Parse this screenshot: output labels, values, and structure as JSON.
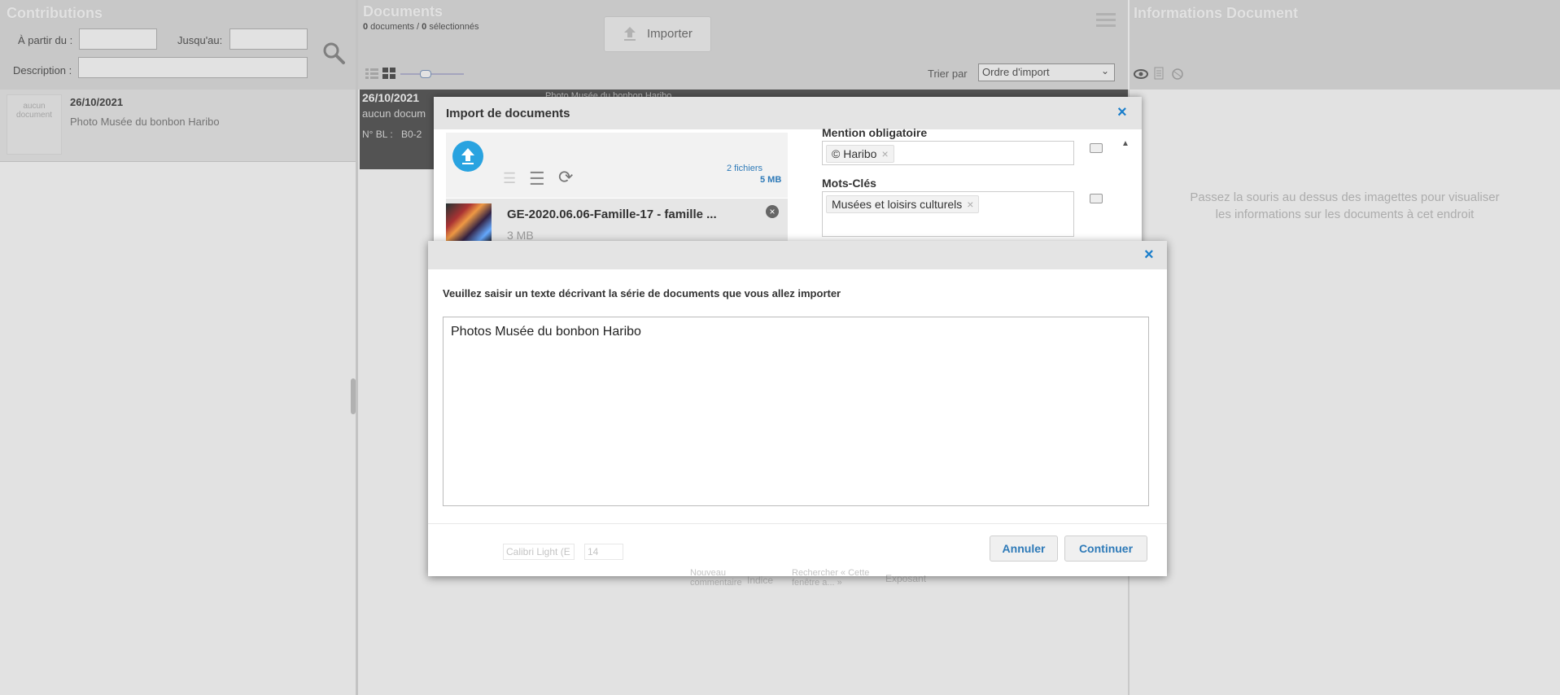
{
  "left": {
    "title": "Contributions",
    "from_label": "À partir du :",
    "to_label": "Jusqu'au:",
    "desc_label": "Description :",
    "item": {
      "thumb_text": "aucun document",
      "date": "26/10/2021",
      "description": "Photo Musée du bonbon Haribo"
    }
  },
  "middle": {
    "title": "Documents",
    "count_zero": "0",
    "count_text": " documents / ",
    "selected_zero": "0",
    "selected_text": " sélectionnés",
    "import_label": "Importer",
    "sort_label": "Trier par",
    "sort_value": "Ordre d'import",
    "card": {
      "date": "26/10/2021",
      "line2": "aucun docum",
      "bl": "N° BL :",
      "bl_value": "B0-2",
      "caption": "Photo Musée du bonbon Haribo"
    }
  },
  "right": {
    "title": "Informations Document",
    "hint_line1": "Passez la souris au dessus des imagettes pour visualiser",
    "hint_line2": "les informations sur les documents à cet endroit"
  },
  "import_dialog": {
    "title": "Import de documents",
    "files_count": "2 fichiers",
    "files_size": "5 MB",
    "file_name": "GE-2020.06.06-Famille-17 - famille ...",
    "file_size": "3 MB",
    "mention_label": "Mention obligatoire",
    "mention_tag": "© Haribo",
    "keywords_label": "Mots-Clés",
    "keyword_tag": "Musées et loisirs culturels"
  },
  "desc_dialog": {
    "prompt": "Veuillez saisir un texte décrivant la série de documents que vous allez importer",
    "textarea_value": "Photos Musée du bonbon Haribo",
    "cancel_label": "Annuler",
    "continue_label": "Continuer"
  },
  "ghost_toolbar": {
    "font": "Calibri Light (E",
    "size": "14",
    "new_comment": "Nouveau commentaire",
    "indice": "Indice",
    "search": "Rechercher « Cette fenêtre a... »",
    "exposant": "Exposant"
  },
  "colors": {
    "accent": "#2e7ab8",
    "upload": "#29a3e0",
    "dark_card": "#3a3a3a"
  }
}
